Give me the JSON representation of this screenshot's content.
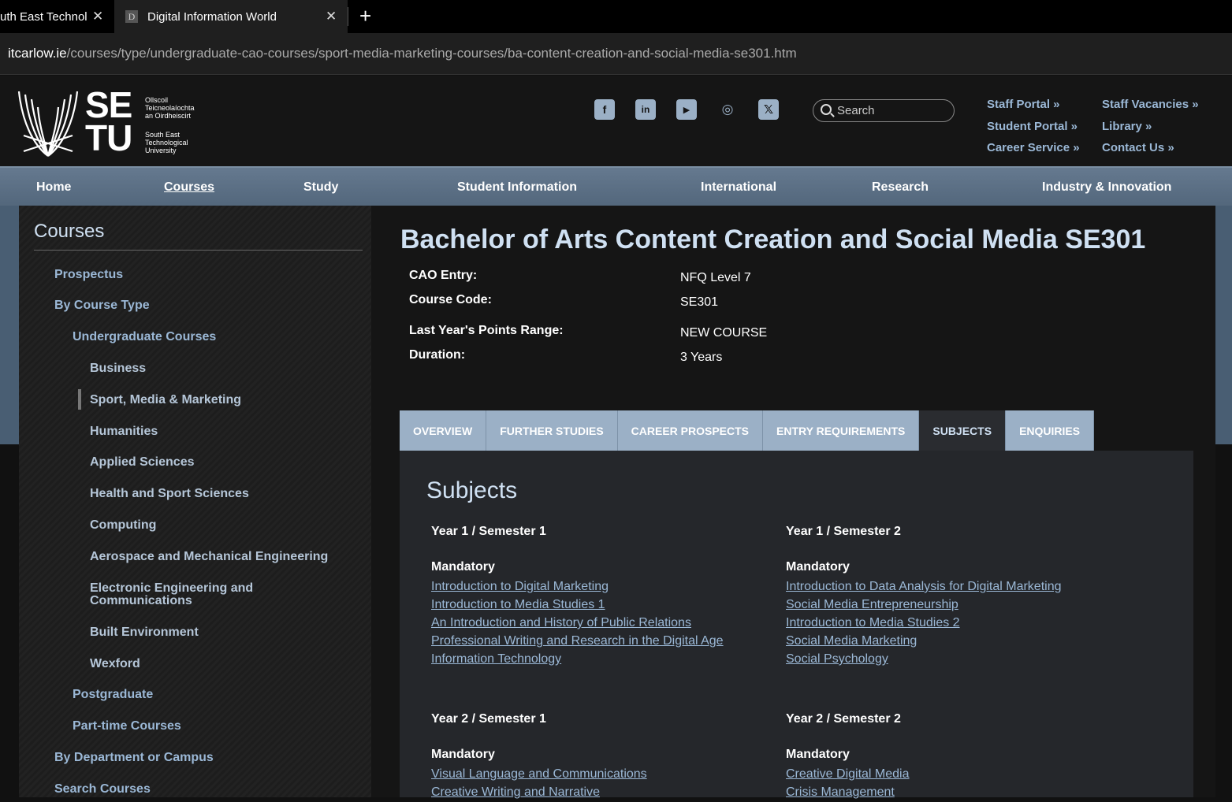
{
  "browser": {
    "tabs": [
      {
        "title": "uth East Technol",
        "active": false
      },
      {
        "title": "Digital Information World",
        "active": true,
        "favicon_letter": "D"
      }
    ],
    "close_glyph": "✕",
    "new_tab_glyph": "+",
    "url_domain": "itcarlow.ie",
    "url_path": "/courses/type/undergraduate-cao-courses/sport-media-marketing-courses/ba-content-creation-and-social-media-se301.htm"
  },
  "header": {
    "logo": {
      "letters_top": "SE",
      "letters_bottom": "TU",
      "irish_lines": [
        "Ollscoil",
        "Teicneolaíochta",
        "an Oirdheiscirt"
      ],
      "english_lines": [
        "South East",
        "Technological",
        "University"
      ]
    },
    "social_icons": [
      {
        "name": "facebook-icon",
        "glyph": "f"
      },
      {
        "name": "linkedin-icon",
        "glyph": "in"
      },
      {
        "name": "youtube-icon",
        "glyph": "▶"
      },
      {
        "name": "instagram-icon",
        "glyph": "◎"
      },
      {
        "name": "x-icon",
        "glyph": "𝕏"
      }
    ],
    "search_placeholder": "Search",
    "quick_links": [
      "Staff Portal »",
      "Student Portal »",
      "Career Service »",
      "Staff Vacancies »",
      "Library »",
      "Contact Us »"
    ]
  },
  "nav": {
    "items": [
      "Home",
      "Courses",
      "Study",
      "Student Information",
      "International",
      "Research",
      "Industry & Innovation"
    ],
    "current": "Courses"
  },
  "sidebar": {
    "title": "Courses",
    "items": [
      "Prospectus",
      "By Course Type",
      "Undergraduate Courses",
      "Business",
      "Sport, Media & Marketing",
      "Humanities",
      "Applied Sciences",
      "Health and Sport Sciences",
      "Computing",
      "Aerospace and Mechanical Engineering",
      "Electronic Engineering and",
      "Communications",
      "Built Environment",
      "Wexford",
      "Postgraduate",
      "Part-time Courses",
      "By Department or Campus",
      "Search Courses"
    ]
  },
  "course": {
    "title": "Bachelor of Arts Content Creation and Social Media SE301",
    "meta": [
      {
        "label": "CAO Entry:",
        "value": "NFQ Level 7"
      },
      {
        "label": "Course Code:",
        "value": "SE301"
      },
      {
        "label": "Last Year's Points Range:",
        "value": "NEW COURSE"
      },
      {
        "label": "Duration:",
        "value": "3 Years"
      }
    ],
    "tabs": [
      "OVERVIEW",
      "FURTHER STUDIES",
      "CAREER PROSPECTS",
      "ENTRY REQUIREMENTS",
      "SUBJECTS",
      "ENQUIRIES"
    ],
    "selected_tab": "SUBJECTS",
    "subjects_heading": "Subjects",
    "mandatory_label": "Mandatory",
    "semesters": [
      {
        "heading": "Year 1 / Semester 1",
        "subjects": [
          "Introduction to Digital Marketing",
          "Introduction to Media Studies 1",
          "An Introduction and History of Public Relations",
          "Professional Writing and Research in the Digital Age",
          "Information Technology"
        ]
      },
      {
        "heading": "Year 1 / Semester 2",
        "subjects": [
          "Introduction to Data Analysis for Digital Marketing",
          "Social Media Entrepreneurship",
          "Introduction to Media Studies 2",
          "Social Media Marketing",
          "Social Psychology"
        ]
      },
      {
        "heading": "Year 2 / Semester 1",
        "subjects": [
          "Visual Language and Communications",
          "Creative Writing and Narrative"
        ]
      },
      {
        "heading": "Year 2 / Semester 2",
        "subjects": [
          "Creative Digital Media",
          "Crisis Management"
        ]
      }
    ]
  },
  "colors": {
    "link": "#9bb8d6",
    "nav_bg": "#5b6f85",
    "tab_bg": "#9bb0c6",
    "panel_bg": "#25272b"
  }
}
